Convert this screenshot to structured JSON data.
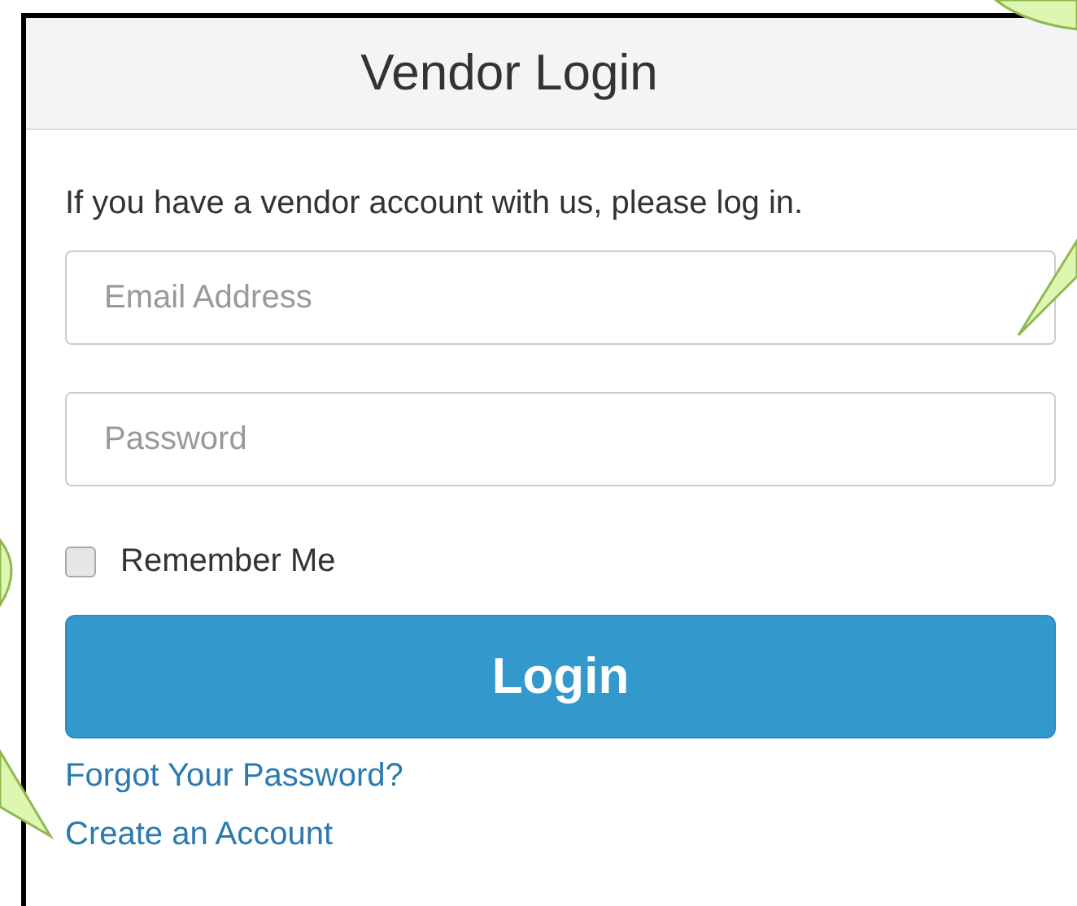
{
  "panel": {
    "title": "Vendor Login",
    "intro": "If you have a vendor account with us, please log in.",
    "fields": [
      {
        "placeholder": "Email Address"
      },
      {
        "placeholder": "Password"
      }
    ],
    "remember": {
      "label": "Remember Me",
      "checked": false
    },
    "button": "Login",
    "links": [
      "Forgot Your Password?",
      "Create an Account"
    ]
  }
}
